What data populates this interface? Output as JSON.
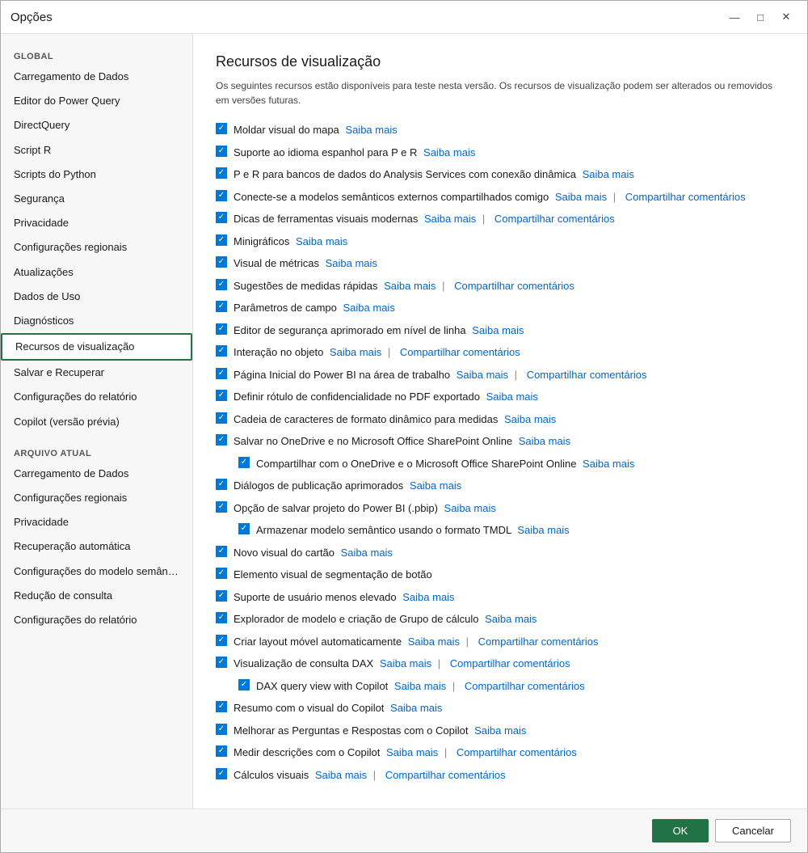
{
  "window": {
    "title": "Opções",
    "minimize_label": "—",
    "maximize_label": "□",
    "close_label": "✕"
  },
  "sidebar": {
    "global_label": "GLOBAL",
    "arquivo_label": "ARQUIVO ATUAL",
    "global_items": [
      {
        "id": "carregamento-dados",
        "label": "Carregamento de Dados",
        "active": false
      },
      {
        "id": "editor-power-query",
        "label": "Editor do Power Query",
        "active": false
      },
      {
        "id": "directquery",
        "label": "DirectQuery",
        "active": false
      },
      {
        "id": "script-r",
        "label": "Script R",
        "active": false
      },
      {
        "id": "scripts-python",
        "label": "Scripts do Python",
        "active": false
      },
      {
        "id": "seguranca",
        "label": "Segurança",
        "active": false
      },
      {
        "id": "privacidade",
        "label": "Privacidade",
        "active": false
      },
      {
        "id": "configuracoes-regionais",
        "label": "Configurações regionais",
        "active": false
      },
      {
        "id": "atualizacoes",
        "label": "Atualizações",
        "active": false
      },
      {
        "id": "dados-uso",
        "label": "Dados de Uso",
        "active": false
      },
      {
        "id": "diagnosticos",
        "label": "Diagnósticos",
        "active": false
      },
      {
        "id": "recursos-visualizacao",
        "label": "Recursos de visualização",
        "active": true
      },
      {
        "id": "salvar-recuperar",
        "label": "Salvar e Recuperar",
        "active": false
      },
      {
        "id": "configuracoes-relatorio",
        "label": "Configurações do relatório",
        "active": false
      },
      {
        "id": "copilot",
        "label": "Copilot (versão prévia)",
        "active": false
      }
    ],
    "arquivo_items": [
      {
        "id": "carregamento-dados-arquivo",
        "label": "Carregamento de Dados",
        "active": false
      },
      {
        "id": "configuracoes-regionais-arquivo",
        "label": "Configurações regionais",
        "active": false
      },
      {
        "id": "privacidade-arquivo",
        "label": "Privacidade",
        "active": false
      },
      {
        "id": "recuperacao-automatica",
        "label": "Recuperação automática",
        "active": false
      },
      {
        "id": "configuracoes-modelo",
        "label": "Configurações do modelo semân…",
        "active": false
      },
      {
        "id": "reducao-consulta",
        "label": "Redução de consulta",
        "active": false
      },
      {
        "id": "configuracoes-relatorio-arquivo",
        "label": "Configurações do relatório",
        "active": false
      }
    ]
  },
  "main": {
    "title": "Recursos de visualização",
    "description": "Os seguintes recursos estão disponíveis para teste nesta versão. Os recursos de visualização podem ser alterados ou removidos em versões futuras.",
    "features": [
      {
        "id": "moldar-visual",
        "text": "Moldar visual do mapa",
        "saiba": "Saiba mais",
        "compartilhar": null,
        "checked": true,
        "indented": false
      },
      {
        "id": "suporte-idioma",
        "text": "Suporte ao idioma espanhol para P e R",
        "saiba": "Saiba mais",
        "compartilhar": null,
        "checked": true,
        "indented": false
      },
      {
        "id": "p-e-r-analysis",
        "text": "P e R para bancos de dados do Analysis Services com conexão dinâmica",
        "saiba": "Saiba mais",
        "compartilhar": null,
        "checked": true,
        "indented": false
      },
      {
        "id": "conecte-modelos",
        "text": "Conecte-se a modelos semânticos externos compartilhados comigo",
        "saiba": "Saiba mais",
        "compartilhar": "Compartilhar comentários",
        "checked": true,
        "indented": false
      },
      {
        "id": "dicas-ferramentas",
        "text": "Dicas de ferramentas visuais modernas",
        "saiba": "Saiba mais",
        "compartilhar": "Compartilhar comentários",
        "checked": true,
        "indented": false
      },
      {
        "id": "minigraficos",
        "text": "Minigráficos",
        "saiba": "Saiba mais",
        "compartilhar": null,
        "checked": true,
        "indented": false
      },
      {
        "id": "visual-metricas",
        "text": "Visual de métricas",
        "saiba": "Saiba mais",
        "compartilhar": null,
        "checked": true,
        "indented": false
      },
      {
        "id": "sugestoes-medidas",
        "text": "Sugestões de medidas rápidas",
        "saiba": "Saiba mais",
        "compartilhar": "Compartilhar comentários",
        "checked": true,
        "indented": false
      },
      {
        "id": "parametros-campo",
        "text": "Parâmetros de campo",
        "saiba": "Saiba mais",
        "compartilhar": null,
        "checked": true,
        "indented": false
      },
      {
        "id": "editor-seguranca",
        "text": "Editor de segurança aprimorado em nível de linha",
        "saiba": "Saiba mais",
        "compartilhar": null,
        "checked": true,
        "indented": false
      },
      {
        "id": "interacao-objeto",
        "text": "Interação no objeto",
        "saiba": "Saiba mais",
        "compartilhar": "Compartilhar comentários",
        "checked": true,
        "indented": false
      },
      {
        "id": "pagina-inicial",
        "text": "Página Inicial do Power BI na área de trabalho",
        "saiba": "Saiba mais",
        "compartilhar": "Compartilhar comentários",
        "checked": true,
        "indented": false
      },
      {
        "id": "rotulo-confidencialidade",
        "text": "Definir rótulo de confidencialidade no PDF exportado",
        "saiba": "Saiba mais",
        "compartilhar": null,
        "checked": true,
        "indented": false
      },
      {
        "id": "cadeia-caracteres",
        "text": "Cadeia de caracteres de formato dinâmico para medidas",
        "saiba": "Saiba mais",
        "compartilhar": null,
        "checked": true,
        "indented": false
      },
      {
        "id": "salvar-onedrive",
        "text": "Salvar no OneDrive e no Microsoft Office SharePoint Online",
        "saiba": "Saiba mais",
        "compartilhar": null,
        "checked": true,
        "indented": false
      },
      {
        "id": "compartilhar-onedrive",
        "text": "Compartilhar com o OneDrive e o Microsoft Office SharePoint Online",
        "saiba": "Saiba mais",
        "compartilhar": null,
        "checked": true,
        "indented": true
      },
      {
        "id": "dialogos-publicacao",
        "text": "Diálogos de publicação aprimorados",
        "saiba": "Saiba mais",
        "compartilhar": null,
        "checked": true,
        "indented": false
      },
      {
        "id": "opcao-salvar-projeto",
        "text": "Opção de salvar projeto do Power BI (.pbip)",
        "saiba": "Saiba mais",
        "compartilhar": null,
        "checked": true,
        "indented": false
      },
      {
        "id": "armazenar-modelo",
        "text": "Armazenar modelo semântico usando o formato TMDL",
        "saiba": "Saiba mais",
        "compartilhar": null,
        "checked": true,
        "indented": true
      },
      {
        "id": "novo-visual-cartao",
        "text": "Novo visual do cartão",
        "saiba": "Saiba mais",
        "compartilhar": null,
        "checked": true,
        "indented": false
      },
      {
        "id": "elemento-segmentacao",
        "text": "Elemento visual de segmentação de botão",
        "saiba": null,
        "compartilhar": null,
        "checked": true,
        "indented": false
      },
      {
        "id": "suporte-usuario",
        "text": "Suporte de usuário menos elevado",
        "saiba": "Saiba mais",
        "compartilhar": null,
        "checked": true,
        "indented": false
      },
      {
        "id": "explorador-modelo",
        "text": "Explorador de modelo e criação de Grupo de cálculo",
        "saiba": "Saiba mais",
        "compartilhar": null,
        "checked": true,
        "indented": false
      },
      {
        "id": "criar-layout",
        "text": "Criar layout móvel automaticamente",
        "saiba": "Saiba mais",
        "compartilhar": "Compartilhar comentários",
        "checked": true,
        "indented": false
      },
      {
        "id": "visualizacao-dax",
        "text": "Visualização de consulta DAX",
        "saiba": "Saiba mais",
        "compartilhar": "Compartilhar comentários",
        "checked": true,
        "indented": false
      },
      {
        "id": "dax-query-copilot",
        "text": "DAX query view with Copilot",
        "saiba": "Saiba mais",
        "compartilhar": "Compartilhar comentários",
        "checked": true,
        "indented": true
      },
      {
        "id": "resumo-copilot",
        "text": "Resumo com o visual do Copilot",
        "saiba": "Saiba mais",
        "compartilhar": null,
        "checked": true,
        "indented": false
      },
      {
        "id": "melhorar-perguntas",
        "text": "Melhorar as Perguntas e Respostas com o Copilot",
        "saiba": "Saiba mais",
        "compartilhar": null,
        "checked": true,
        "indented": false
      },
      {
        "id": "medir-descricoes",
        "text": "Medir descrições com o Copilot",
        "saiba": "Saiba mais",
        "compartilhar": "Compartilhar comentários",
        "checked": true,
        "indented": false
      },
      {
        "id": "calculos-visuais",
        "text": "Cálculos visuais",
        "saiba": "Saiba mais",
        "compartilhar": "Compartilhar comentários",
        "checked": true,
        "indented": false
      }
    ]
  },
  "footer": {
    "ok_label": "OK",
    "cancel_label": "Cancelar"
  }
}
